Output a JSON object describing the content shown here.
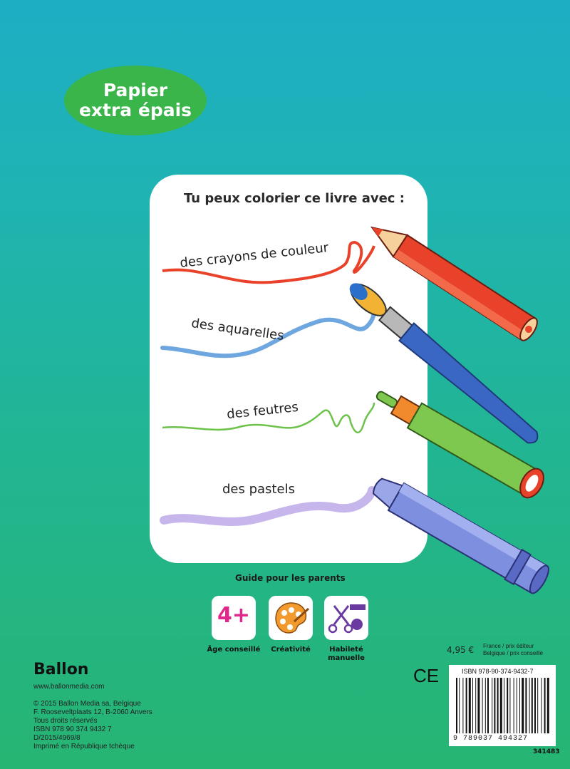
{
  "badge": {
    "line1": "Papier",
    "line2": "extra épais"
  },
  "card": {
    "title": "Tu peux colorier ce livre avec :",
    "items": [
      {
        "label": "des crayons de couleur",
        "color": "#e8432a"
      },
      {
        "label": "des aquarelles",
        "color": "#6ea6e0"
      },
      {
        "label": "des feutres",
        "color": "#6cc24a"
      },
      {
        "label": "des pastels",
        "color": "#b9a4e6"
      }
    ]
  },
  "guide": {
    "title": "Guide pour les parents",
    "tiles": [
      {
        "label": "Âge conseillé",
        "value": "4+"
      },
      {
        "label": "Créativité"
      },
      {
        "label": "Habileté manuelle"
      }
    ]
  },
  "publisher": {
    "logo": "Ballon",
    "url": "www.ballonmedia.com",
    "lines": [
      "© 2015 Ballon Media sa, Belgique",
      "F. Rooseveltplaats 12, B-2060 Anvers",
      "Tous droits réservés",
      "ISBN 978 90 374 9432 7",
      "D/2015/4969/8",
      "Imprimé en République tchèque"
    ]
  },
  "price": {
    "amount": "4,95 €",
    "note1": "France / prix éditeur",
    "note2": "Belgique / prix conseillé"
  },
  "ce_mark": "CE",
  "barcode": {
    "isbn": "ISBN 978-90-374-9432-7",
    "digits": "9 789037 494327",
    "code": "341483"
  }
}
